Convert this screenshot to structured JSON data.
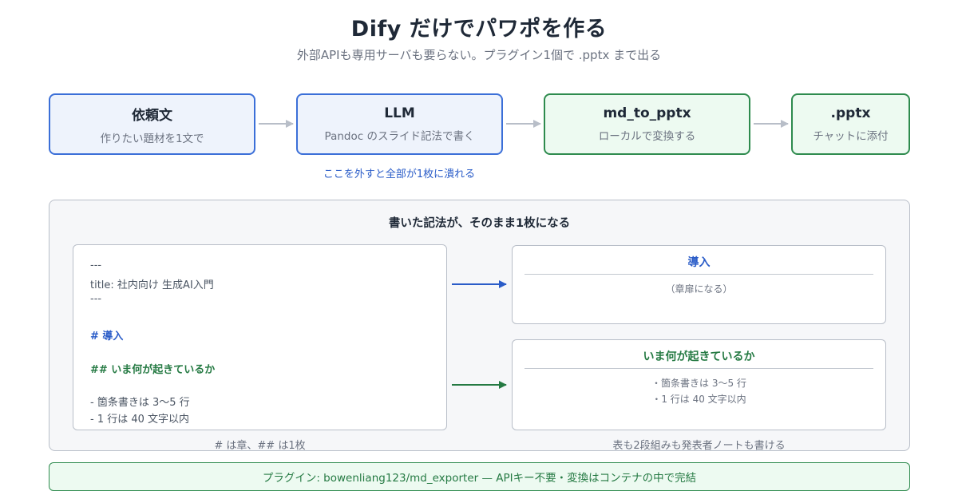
{
  "header": {
    "title": "Dify だけでパワポを作る",
    "subtitle": "外部APIも専用サーバも要らない。プラグイン1個で .pptx まで出る"
  },
  "flow": {
    "steps": [
      {
        "label": "依頼文",
        "desc": "作りたい題材を1文で",
        "variant": "blue"
      },
      {
        "label": "LLM",
        "desc": "Pandoc のスライド記法で書く",
        "variant": "blue"
      },
      {
        "label": "md_to_pptx",
        "desc": "ローカルで変換する",
        "variant": "green"
      },
      {
        "label": ".pptx",
        "desc": "チャットに添付",
        "variant": "green"
      }
    ],
    "llm_note": "ここを外すと全部が1枚に潰れる"
  },
  "example": {
    "title": "書いた記法が、そのまま1枚になる",
    "markdown_lines": [
      "---",
      "title: 社内向け 生成AI入門",
      "---",
      "# 導入",
      "## いま何が起きているか",
      "- 箇条書きは 3〜5 行",
      "- 1 行は 40 文字以内"
    ],
    "slides": [
      {
        "title": "導入",
        "lines": [
          "（章扉になる）"
        ]
      },
      {
        "title": "いま何が起きているか",
        "lines": [
          "・箇条書きは 3〜5 行",
          "・1 行は 40 文字以内"
        ]
      }
    ],
    "left_caption": "# は章、## は1枚",
    "right_caption": "表も2段組みも発表者ノートも書ける"
  },
  "footer": {
    "text": "プラグイン: bowenliang123/md_exporter — APIキー不要・変換はコンテナの中で完結"
  },
  "colors": {
    "blue": "#3b6fd8",
    "green": "#2e8b4e",
    "arrow_gray": "#b8bec8"
  }
}
